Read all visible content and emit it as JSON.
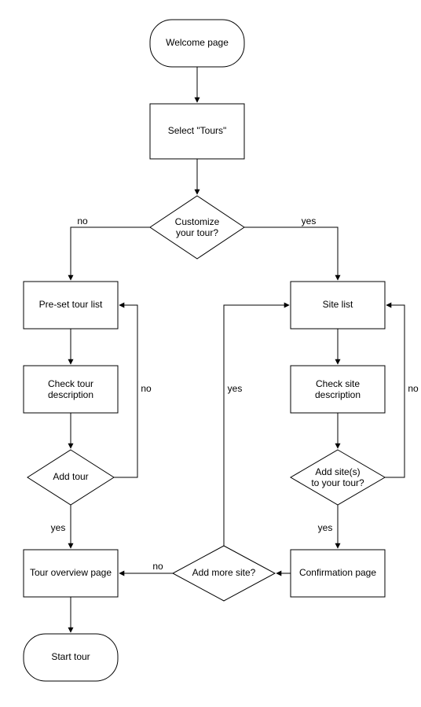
{
  "nodes": {
    "welcome": "Welcome page",
    "select_tours": "Select \"Tours\"",
    "customize": {
      "l1": "Customize",
      "l2": "your tour?"
    },
    "preset_list": "Pre-set tour list",
    "site_list": "Site list",
    "check_tour": {
      "l1": "Check tour",
      "l2": "description"
    },
    "check_site": {
      "l1": "Check site",
      "l2": "description"
    },
    "add_tour": "Add tour",
    "add_site": {
      "l1": "Add site(s)",
      "l2": "to your tour?"
    },
    "tour_overview": "Tour overview page",
    "confirmation": "Confirmation page",
    "add_more": "Add more site?",
    "start_tour": "Start tour"
  },
  "labels": {
    "no": "no",
    "yes": "yes"
  }
}
